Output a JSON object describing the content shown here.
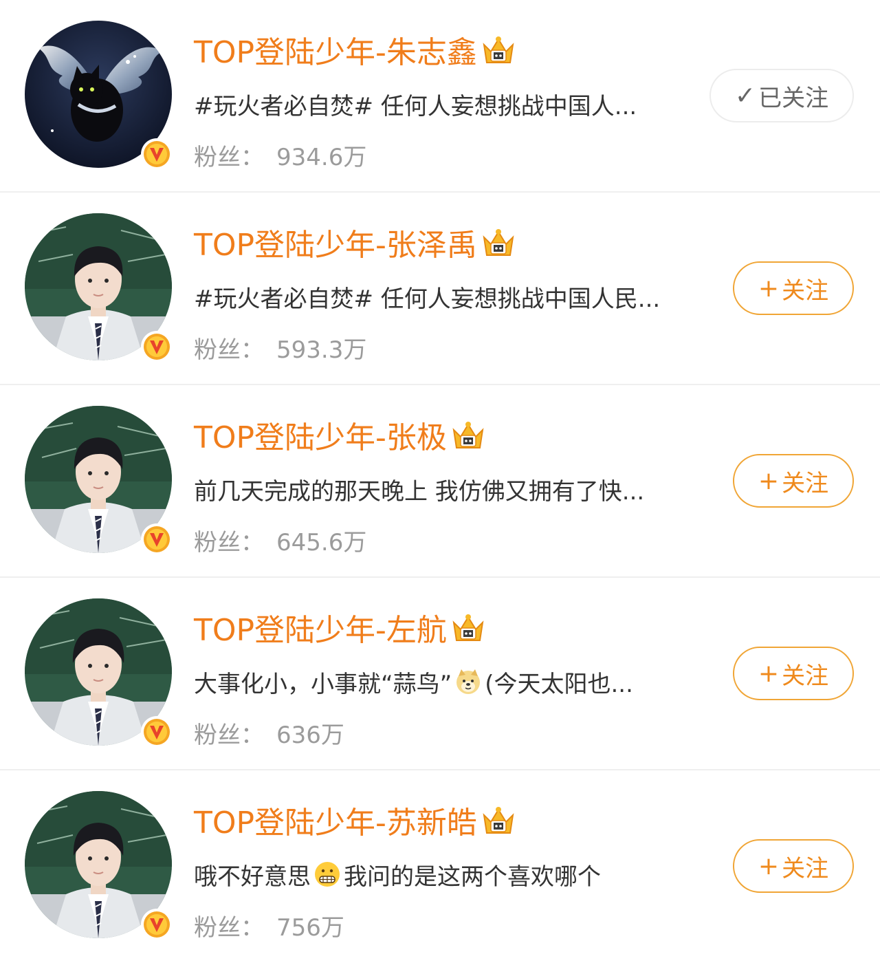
{
  "fans_label": "粉丝：",
  "colors": {
    "name_orange": "#f07d1b",
    "follow_border": "#f0a535",
    "fans_gray": "#9b9b9b",
    "verified_badge": "#f5a623"
  },
  "users": [
    {
      "name": "TOP登陆少年-朱志鑫",
      "post_parts": [
        "#玩火者必自焚# 任何人妄想挑战中国人..."
      ],
      "fans": "934.6万",
      "button": {
        "state": "followed",
        "icon": "✓",
        "label": "已关注"
      },
      "avatar": "black-cat-with-wings"
    },
    {
      "name": "TOP登陆少年-张泽禹",
      "post_parts": [
        "#玩火者必自焚# 任何人妄想挑战中国人民..."
      ],
      "fans": "593.3万",
      "button": {
        "state": "follow",
        "icon": "+",
        "label": "关注"
      },
      "avatar": "boy-in-light-suit-classroom"
    },
    {
      "name": "TOP登陆少年-张极",
      "post_parts": [
        "前几天完成的那天晚上 我仿佛又拥有了快..."
      ],
      "fans": "645.6万",
      "button": {
        "state": "follow",
        "icon": "+",
        "label": "关注"
      },
      "avatar": "boy-in-light-suit-classroom"
    },
    {
      "name": "TOP登陆少年-左航",
      "post_parts": [
        "大事化小，小事就“蒜鸟”",
        "(今天太阳也..."
      ],
      "post_emoji": "doge-emoji",
      "fans": "636万",
      "button": {
        "state": "follow",
        "icon": "+",
        "label": "关注"
      },
      "avatar": "boy-in-light-suit-classroom"
    },
    {
      "name": "TOP登陆少年-苏新皓",
      "post_parts": [
        "哦不好意思",
        " 我问的是这两个喜欢哪个"
      ],
      "post_emoji": "grimace-emoji",
      "fans": "756万",
      "button": {
        "state": "follow",
        "icon": "+",
        "label": "关注"
      },
      "avatar": "boy-in-light-suit-classroom"
    }
  ]
}
